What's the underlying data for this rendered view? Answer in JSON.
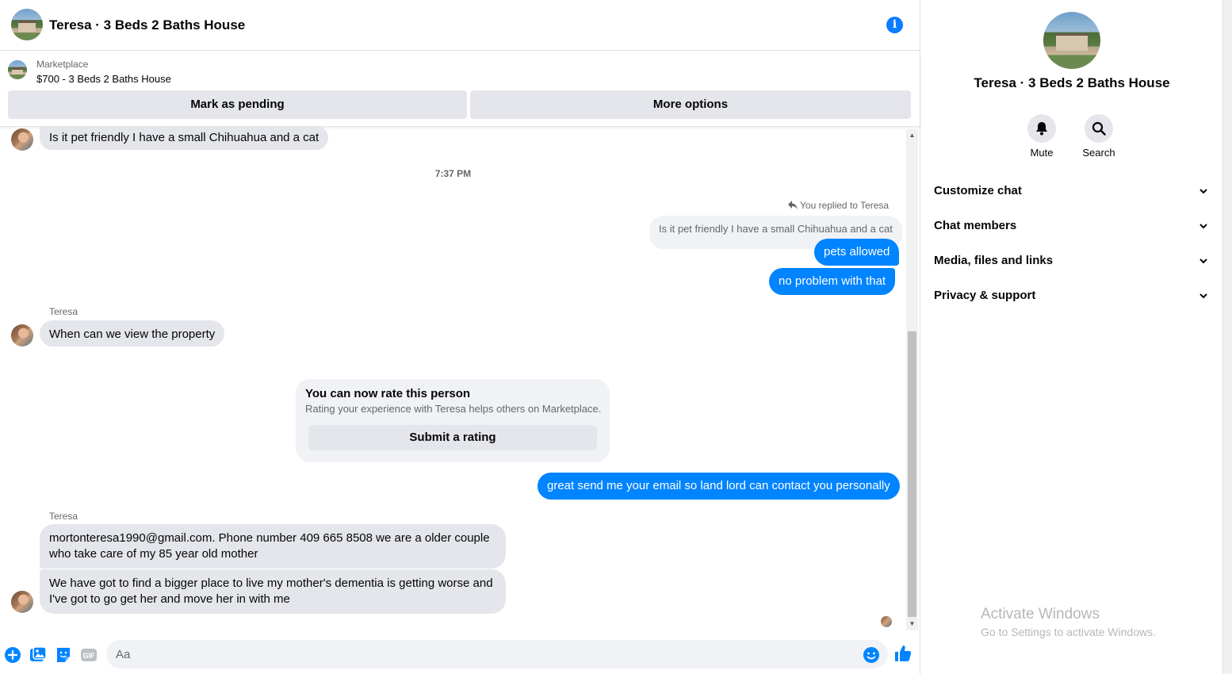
{
  "header": {
    "title": "Teresa · 3 Beds 2 Baths House"
  },
  "marketplace": {
    "label": "Marketplace",
    "item": "$700 - 3 Beds 2 Baths House",
    "mark_pending_label": "Mark as pending",
    "more_options_label": "More options"
  },
  "messages": {
    "msg1": "Is it pet friendly I have a small Chihuahua and a cat",
    "timestamp": "7:37 PM",
    "replied_note": "You replied to Teresa",
    "quoted": "Is it pet friendly I have a small Chihuahua and a cat",
    "out1": "pets allowed",
    "out2": "no problem with that",
    "sender1": "Teresa",
    "msg2": "When can we view the property",
    "rate_title": "You can now rate this person",
    "rate_sub": "Rating your experience with Teresa helps others on Marketplace.",
    "rate_button": "Submit a rating",
    "out3": "great send me your email so land lord can contact you personally",
    "sender2": "Teresa",
    "msg3": "mortonteresa1990@gmail.com.  Phone number 409 665 8508   we are a older couple who take care of my 85 year old mother",
    "msg4": "We have got to find a bigger place to live my mother's dementia is getting worse and I've got to go get her and move her in with me"
  },
  "composer": {
    "placeholder": "Aa"
  },
  "side": {
    "title": "Teresa · 3 Beds 2 Baths House",
    "mute_label": "Mute",
    "search_label": "Search",
    "menu": [
      "Customize chat",
      "Chat members",
      "Media, files and links",
      "Privacy & support"
    ]
  },
  "watermark": {
    "line1": "Activate Windows",
    "line2": "Go to Settings to activate Windows."
  },
  "colors": {
    "accent": "#0084ff",
    "bubble_in": "#e4e6eb",
    "info": "#0a7cff"
  }
}
